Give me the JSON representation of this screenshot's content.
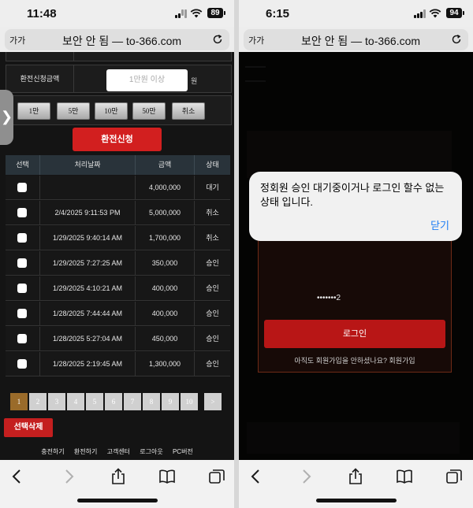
{
  "left": {
    "status": {
      "time": "11:48",
      "battery": "89"
    },
    "urlbar": {
      "aa": "가가",
      "url": "보안 안 됨 — to-366.com"
    },
    "form": {
      "amount_label": "환전신청금액",
      "amount_placeholder": "1만원 이상",
      "unit": "원",
      "quick_buttons": [
        "1만",
        "5만",
        "10만",
        "50만",
        "취소"
      ],
      "submit": "환전신청"
    },
    "table": {
      "headers": [
        "선택",
        "처리날짜",
        "금액",
        "상태"
      ],
      "rows": [
        {
          "date": "",
          "amount": "4,000,000",
          "status": "대기"
        },
        {
          "date": "2/4/2025 9:11:53 PM",
          "amount": "5,000,000",
          "status": "취소"
        },
        {
          "date": "1/29/2025 9:40:14 AM",
          "amount": "1,700,000",
          "status": "취소"
        },
        {
          "date": "1/29/2025 7:27:25 AM",
          "amount": "350,000",
          "status": "승인"
        },
        {
          "date": "1/29/2025 4:10:21 AM",
          "amount": "400,000",
          "status": "승인"
        },
        {
          "date": "1/28/2025 7:44:44 AM",
          "amount": "400,000",
          "status": "승인"
        },
        {
          "date": "1/28/2025 5:27:04 AM",
          "amount": "450,000",
          "status": "승인"
        },
        {
          "date": "1/28/2025 2:19:45 AM",
          "amount": "1,300,000",
          "status": "승인"
        }
      ]
    },
    "pagination": [
      "1",
      "2",
      "3",
      "4",
      "5",
      "6",
      "7",
      "8",
      "9",
      "10",
      ">"
    ],
    "delete_button": "선택삭제",
    "footer_links": [
      "충전하기",
      "환전하기",
      "고객센터",
      "로그아웃",
      "PC버전"
    ]
  },
  "right": {
    "status": {
      "time": "6:15",
      "battery": "94"
    },
    "urlbar": {
      "aa": "가가",
      "url": "보안 안 됨 — to-366.com"
    },
    "alert": {
      "message": "정회원 승인 대기중이거나 로그인 할수 없는 상태 입니다.",
      "close": "닫기"
    },
    "login": {
      "password_masked": "•••••••2",
      "button": "로그인",
      "signup_prompt": "아직도 회원가입을 안하셨나요? 회원가입"
    }
  },
  "colors": {
    "accent_red": "#d21f1f",
    "ios_blue": "#1b7cf5",
    "page_bg": "#141414"
  }
}
